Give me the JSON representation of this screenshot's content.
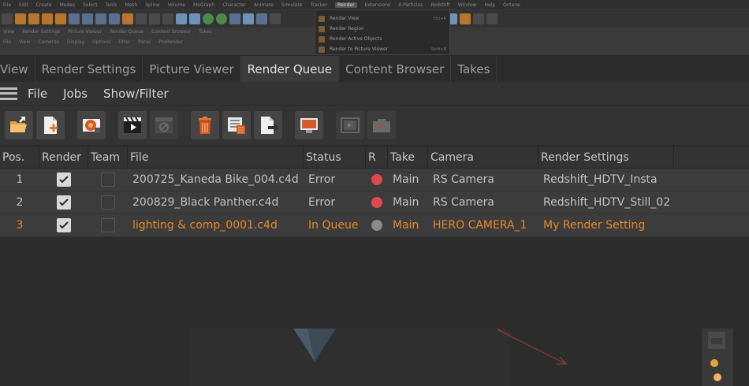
{
  "chrome": {
    "menus": [
      "File",
      "Edit",
      "Create",
      "Modes",
      "Select",
      "Tools",
      "Mesh",
      "Spline",
      "Volume",
      "MoGraph",
      "Character",
      "Animate",
      "Simulate",
      "Tracker",
      "Render",
      "Extensions",
      "X-Particles",
      "Redshift",
      "Window",
      "Help",
      "Octane"
    ],
    "active_menu": "Render",
    "sub_menus": [
      "View",
      "Render Settings",
      "Picture Viewer",
      "Render Queue",
      "Content Browser",
      "Takes"
    ],
    "sub_menus2": [
      "File",
      "View",
      "Cameras",
      "Display",
      "Options",
      "Filter",
      "Panel",
      "ProRender"
    ],
    "dropdown": [
      {
        "label": "Render View",
        "shortcut": "Ctrl+R"
      },
      {
        "label": "Render Region",
        "shortcut": ""
      },
      {
        "label": "Render Active Objects",
        "shortcut": ""
      },
      {
        "label": "Render to Picture Viewer",
        "shortcut": "Shift+R"
      }
    ]
  },
  "tabs": [
    {
      "label": "View",
      "active": false
    },
    {
      "label": "Render Settings",
      "active": false
    },
    {
      "label": "Picture Viewer",
      "active": false
    },
    {
      "label": "Render Queue",
      "active": true
    },
    {
      "label": "Content Browser",
      "active": false
    },
    {
      "label": "Takes",
      "active": false
    }
  ],
  "menu": {
    "file": "File",
    "jobs": "Jobs",
    "show_filter": "Show/Filter"
  },
  "toolbar": {
    "icons": [
      "open-folder-icon",
      "add-file-icon",
      "render-settings-icon",
      "clapper-play-icon",
      "stop-render-icon",
      "trash-icon",
      "queue-list-icon",
      "export-file-icon",
      "monitor-icon",
      "render-view-icon",
      "camera-icon"
    ]
  },
  "table": {
    "headers": [
      "Pos.",
      "Render",
      "Team",
      "File",
      "Status",
      "R",
      "Take",
      "Camera",
      "Render Settings"
    ],
    "rows": [
      {
        "pos": "1",
        "render": true,
        "team": false,
        "file": "200725_Kaneda Bike_004.c4d",
        "status": "Error",
        "r_color": "#e0474f",
        "take": "Main",
        "camera": "RS Camera",
        "render_settings": "Redshift_HDTV_Insta",
        "queued": false
      },
      {
        "pos": "2",
        "render": true,
        "team": false,
        "file": "200829_Black Panther.c4d",
        "status": "Error",
        "r_color": "#e0474f",
        "take": "Main",
        "camera": "RS Camera",
        "render_settings": "Redshift_HDTV_Still_02",
        "queued": false
      },
      {
        "pos": "3",
        "render": true,
        "team": false,
        "file": "lighting & comp_0001.c4d",
        "status": "In Queue",
        "r_color": "#8a8a8a",
        "take": "Main",
        "camera": "HERO CAMERA_1",
        "render_settings": "My Render Setting",
        "queued": true
      }
    ]
  },
  "colors": {
    "accent_orange": "#e8882c",
    "error_red": "#e0474f",
    "idle_gray": "#8a8a8a",
    "bg": "#2b2b2b"
  }
}
